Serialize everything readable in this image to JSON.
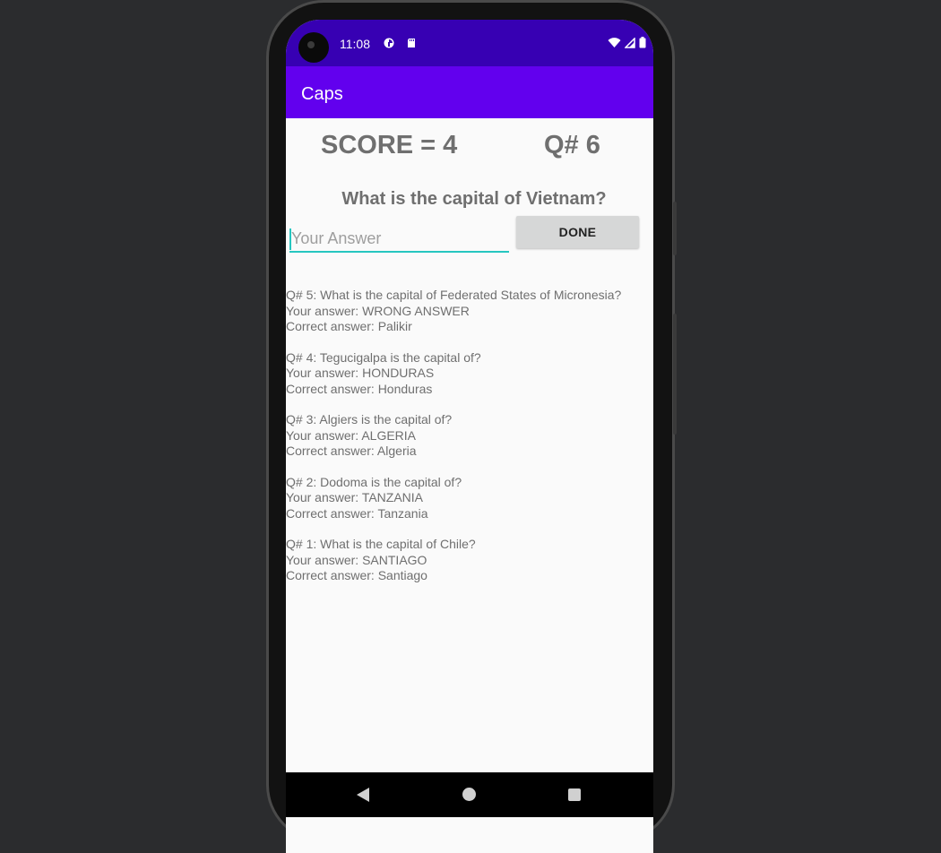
{
  "status_bar": {
    "time": "11:08",
    "icons": [
      "camera-icon",
      "data-saver-icon",
      "sd-card-icon",
      "wifi-icon",
      "signal-icon",
      "battery-icon"
    ]
  },
  "app_bar": {
    "title": "Caps"
  },
  "quiz": {
    "score_text": "SCORE = 4",
    "question_number_text": "Q# 6",
    "question": "What is the capital of Vietnam?",
    "answer_placeholder": "Your Answer",
    "answer_value": "",
    "done_label": "DONE"
  },
  "history": [
    {
      "question": "Q# 5: What is the capital of Federated States of Micronesia?",
      "your_answer": "Your answer: WRONG ANSWER",
      "correct_answer": "Correct answer: Palikir"
    },
    {
      "question": "Q# 4: Tegucigalpa is the capital of?",
      "your_answer": "Your answer: HONDURAS",
      "correct_answer": "Correct answer: Honduras"
    },
    {
      "question": "Q# 3: Algiers is the capital of?",
      "your_answer": "Your answer: ALGERIA",
      "correct_answer": "Correct answer: Algeria"
    },
    {
      "question": "Q# 2: Dodoma is the capital of?",
      "your_answer": "Your answer: TANZANIA",
      "correct_answer": "Correct answer: Tanzania"
    },
    {
      "question": "Q# 1: What is the capital of Chile?",
      "your_answer": "Your answer: SANTIAGO",
      "correct_answer": "Correct answer: Santiago"
    }
  ],
  "colors": {
    "status_bar": "#3700b3",
    "app_bar": "#6200ee",
    "accent": "#26c6c0",
    "text_gray": "#6f6f6f",
    "button": "#d6d7d7"
  }
}
